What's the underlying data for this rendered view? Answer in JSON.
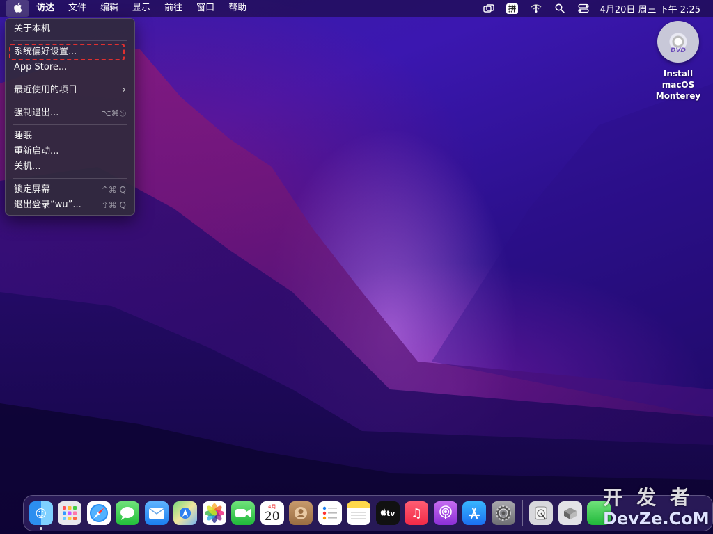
{
  "menubar": {
    "apple_icon": "apple-logo-icon",
    "items": [
      "访达",
      "文件",
      "编辑",
      "显示",
      "前往",
      "窗口",
      "帮助"
    ],
    "ime_label": "拼",
    "clock": "4月20日 周三 下午 2:25"
  },
  "apple_menu": {
    "about": "关于本机",
    "system_prefs": "系统偏好设置...",
    "app_store": "App Store...",
    "recent_items": "最近使用的项目",
    "force_quit": "强制退出...",
    "force_quit_shortcut": "⌥⌘⎋",
    "sleep": "睡眠",
    "restart": "重新启动...",
    "shutdown": "关机...",
    "lock_screen": "锁定屏幕",
    "lock_shortcut": "^⌘ Q",
    "logout": "退出登录“wu”...",
    "logout_shortcut": "⇧⌘ Q"
  },
  "desktop": {
    "install_icon_label_line1": "Install macOS",
    "install_icon_label_line2": "Monterey",
    "disc_text": "DVD"
  },
  "dock": {
    "calendar_month": "4月",
    "calendar_day": "20",
    "tv_label": "tv"
  },
  "watermark": {
    "top": "开发者",
    "bottom": "DevZe.CoM"
  },
  "colors": {
    "highlight": "#e03030",
    "menu_bg": "#302a3c"
  }
}
